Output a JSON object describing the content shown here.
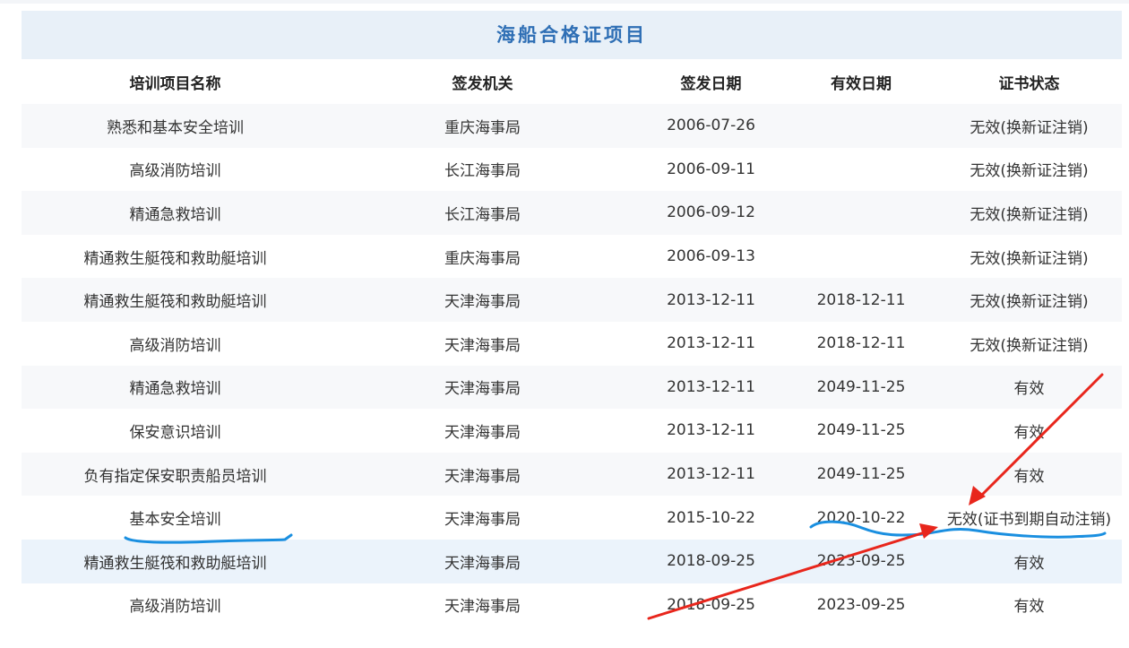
{
  "panel": {
    "title": "海船合格证项目"
  },
  "table": {
    "headers": [
      "培训项目名称",
      "签发机关",
      "签发日期",
      "有效日期",
      "证书状态"
    ],
    "rows": [
      [
        "熟悉和基本安全培训",
        "重庆海事局",
        "2006-07-26",
        "",
        "无效(换新证注销)"
      ],
      [
        "高级消防培训",
        "长江海事局",
        "2006-09-11",
        "",
        "无效(换新证注销)"
      ],
      [
        "精通急救培训",
        "长江海事局",
        "2006-09-12",
        "",
        "无效(换新证注销)"
      ],
      [
        "精通救生艇筏和救助艇培训",
        "重庆海事局",
        "2006-09-13",
        "",
        "无效(换新证注销)"
      ],
      [
        "精通救生艇筏和救助艇培训",
        "天津海事局",
        "2013-12-11",
        "2018-12-11",
        "无效(换新证注销)"
      ],
      [
        "高级消防培训",
        "天津海事局",
        "2013-12-11",
        "2018-12-11",
        "无效(换新证注销)"
      ],
      [
        "精通急救培训",
        "天津海事局",
        "2013-12-11",
        "2049-11-25",
        "有效"
      ],
      [
        "保安意识培训",
        "天津海事局",
        "2013-12-11",
        "2049-11-25",
        "有效"
      ],
      [
        "负有指定保安职责船员培训",
        "天津海事局",
        "2013-12-11",
        "2049-11-25",
        "有效"
      ],
      [
        "基本安全培训",
        "天津海事局",
        "2015-10-22",
        "2020-10-22",
        "无效(证书到期自动注销)"
      ],
      [
        "精通救生艇筏和救助艇培训",
        "天津海事局",
        "2018-09-25",
        "2023-09-25",
        "有效"
      ],
      [
        "高级消防培训",
        "天津海事局",
        "2018-09-25",
        "2023-09-25",
        "有效"
      ]
    ]
  },
  "colors": {
    "title_text": "#2f6fb5",
    "title_bg": "#e8f0f8",
    "annotation_blue": "#1a8fe0",
    "annotation_red": "#e8261c"
  }
}
